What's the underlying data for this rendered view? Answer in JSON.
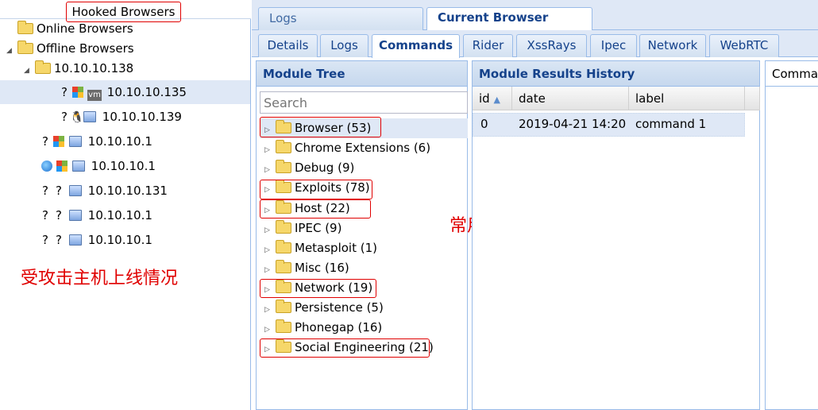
{
  "left": {
    "title": "Hooked Browsers",
    "online": "Online Browsers",
    "offline": "Offline Browsers",
    "group": "10.10.10.138",
    "hosts": [
      {
        "ip": "10.10.10.135"
      },
      {
        "ip": "10.10.10.139"
      },
      {
        "ip": "10.10.10.1"
      },
      {
        "ip": "10.10.10.1"
      },
      {
        "ip": "10.10.10.131"
      },
      {
        "ip": "10.10.10.1"
      },
      {
        "ip": "10.10.10.1"
      }
    ],
    "annotation": "受攻击主机上线情况"
  },
  "top_tabs": [
    "Logs",
    "Current Browser"
  ],
  "sub_tabs": [
    "Details",
    "Logs",
    "Commands",
    "Rider",
    "XssRays",
    "Ipec",
    "Network",
    "WebRTC"
  ],
  "module_tree": {
    "title": "Module Tree",
    "search_placeholder": "Search",
    "items": [
      "Browser (53)",
      "Chrome Extensions (6)",
      "Debug (9)",
      "Exploits (78)",
      "Host (22)",
      "IPEC (9)",
      "Metasploit (1)",
      "Misc (16)",
      "Network (19)",
      "Persistence (5)",
      "Phonegap (16)",
      "Social Engineering (21)"
    ],
    "annotation": "常用模块"
  },
  "results": {
    "title": "Module Results History",
    "columns": [
      "id",
      "date",
      "label"
    ],
    "rows": [
      {
        "id": "0",
        "date": "2019-04-21 14:20",
        "label": "command 1"
      }
    ]
  },
  "command_panel": {
    "title": "Comman"
  },
  "colors": {
    "annotation_red": "#e00000",
    "panel_blue": "#15428b",
    "selection": "#dfe8f6"
  }
}
